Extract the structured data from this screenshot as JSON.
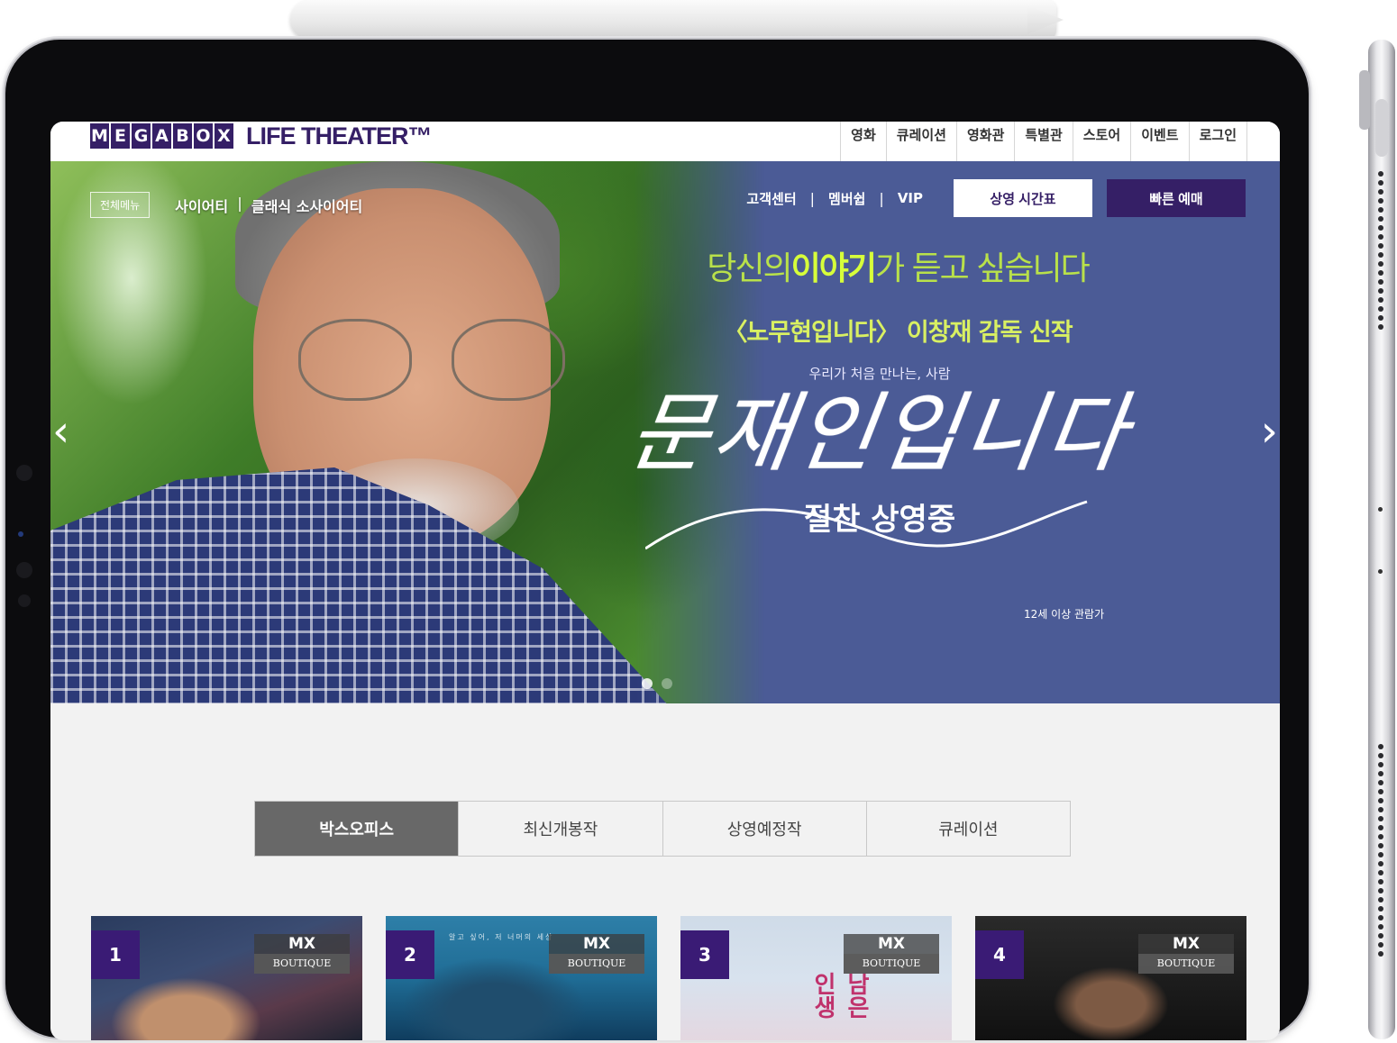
{
  "header": {
    "logo_letters": [
      "M",
      "E",
      "G",
      "A",
      "B",
      "O",
      "X"
    ],
    "logo_tagline": "LIFE THEATER™",
    "nav": [
      "영화",
      "큐레이션",
      "영화관",
      "특별관",
      "스토어",
      "이벤트",
      "로그인"
    ]
  },
  "hero": {
    "all_menu": "전체메뉴",
    "society_links": [
      "사이어티",
      "클래식 소사이어티"
    ],
    "util_links": [
      "고객센터",
      "멤버쉽",
      "VIP"
    ],
    "timetable_button": "상영 시간표",
    "booking_button": "빠른 예매",
    "headline_prefix": "당신의",
    "headline_emph": "이야기",
    "headline_suffix": "가 듣고 싶습니다",
    "subline": "〈노무현입니다〉 이창재 감독 신작",
    "small_copy": "우리가 처음 만나는, 사람",
    "calligraphy": "문재인입니다",
    "now_showing": "절찬 상영중",
    "rating": "12세 이상 관람가",
    "prev_arrow": "‹",
    "next_arrow": "›",
    "colors": {
      "hero_bg": "#4b5b96",
      "headline": "#b9e14a",
      "brand": "#351f66"
    }
  },
  "tabs": [
    {
      "label": "박스오피스",
      "active": true
    },
    {
      "label": "최신개봉작",
      "active": false
    },
    {
      "label": "상영예정작",
      "active": false
    },
    {
      "label": "큐레이션",
      "active": false
    }
  ],
  "cards": [
    {
      "rank": "1",
      "mx": "MX",
      "boutique": "BOUTIQUE"
    },
    {
      "rank": "2",
      "mx": "MX",
      "boutique": "BOUTIQUE"
    },
    {
      "rank": "3",
      "mx": "MX",
      "boutique": "BOUTIQUE"
    },
    {
      "rank": "4",
      "mx": "MX",
      "boutique": "BOUTIQUE"
    }
  ],
  "poster_texts": {
    "card2": "알고 싶어, 저 너머의 세상",
    "card3_title": "남은 인생"
  }
}
